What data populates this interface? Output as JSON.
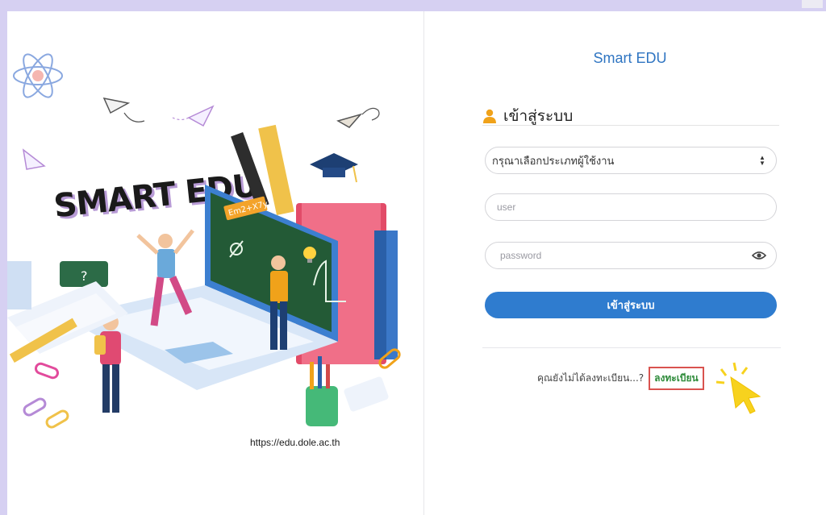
{
  "illustration": {
    "headline": "SMART EDU",
    "url": "https://edu.dole.ac.th",
    "board_formula": "Em2+X7y"
  },
  "login": {
    "brand_title": "Smart EDU",
    "heading": "เข้าสู่ระบบ",
    "user_type_select": {
      "selected": "กรุณาเลือกประเภทผู้ใช้งาน"
    },
    "username": {
      "value": "",
      "placeholder": "user"
    },
    "password": {
      "value": "",
      "placeholder": "password"
    },
    "submit_label": "เข้าสู่ระบบ",
    "register_prompt": "คุณยังไม่ได้ลงทะเบียน...?",
    "register_link": "ลงทะเบียน"
  },
  "colors": {
    "accent_blue": "#2f7ccf",
    "brand_blue": "#2f75c2",
    "register_green": "#2e8b3a",
    "highlight_red": "#d9534f",
    "frame_lavender": "#d6d0f2",
    "cursor_yellow": "#f7d21e"
  },
  "icons": [
    "user-icon",
    "eye-icon",
    "select-arrows-icon",
    "hand-cursor-icon"
  ]
}
